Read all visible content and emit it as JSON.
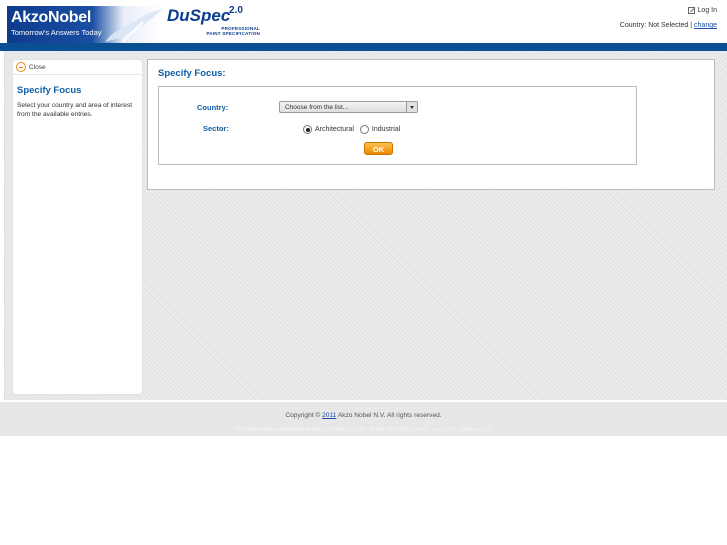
{
  "header": {
    "brand": "AkzoNobel",
    "tagline": "Tomorrow's Answers Today",
    "product_name": "DuSpec",
    "product_version": "2.0",
    "product_sub1": "PROFESSIONAL",
    "product_sub2": "PAINT SPECIFICATION",
    "login_label": "Log In",
    "country_label": "Country:",
    "country_value": "Not Selected",
    "change_link": "change",
    "bar_color": "#0a4f91"
  },
  "sidebar": {
    "close_label": "Close",
    "title": "Specify Focus",
    "description": "Select your country and area of interest from the available entries."
  },
  "panel": {
    "title": "Specify Focus:",
    "country_label": "Country:",
    "country_select": "Choose from the list...",
    "sector_label": "Sector:",
    "sector_options": [
      "Architectural",
      "Industrial"
    ],
    "sector_selected": "Architectural",
    "ok_label": "OK"
  },
  "footer": {
    "copyright_prefix": "Copyright ©",
    "copyright_year": "2011",
    "copyright_suffix": "Akzo Nobel N.V. All rights reserved.",
    "version_text": "DSS Web Release Application Version 2.1 Build 1.0.0.40 - 05-Apr-2011 09:51:16:49 - Java 1.6.0 - Jakarta 1.0.11"
  }
}
